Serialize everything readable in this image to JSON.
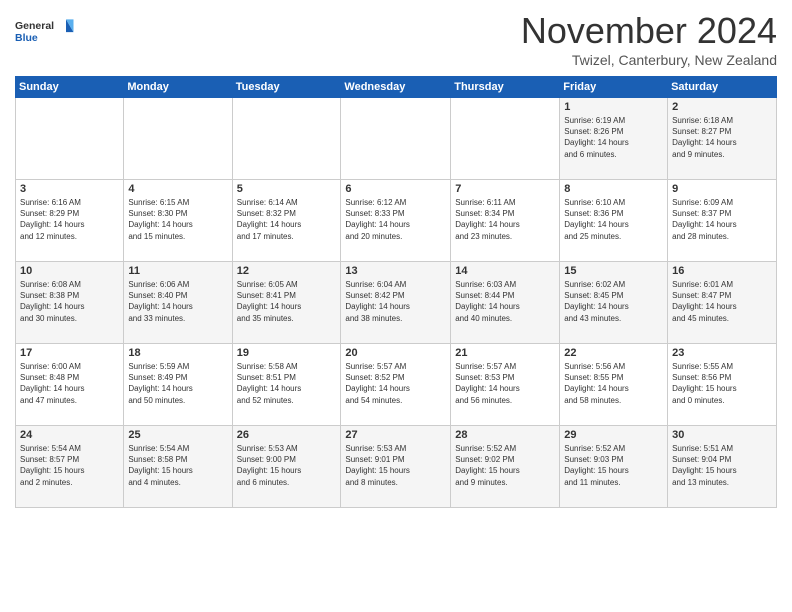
{
  "header": {
    "logo_general": "General",
    "logo_blue": "Blue",
    "month_title": "November 2024",
    "location": "Twizel, Canterbury, New Zealand"
  },
  "weekdays": [
    "Sunday",
    "Monday",
    "Tuesday",
    "Wednesday",
    "Thursday",
    "Friday",
    "Saturday"
  ],
  "weeks": [
    [
      {
        "day": "",
        "info": ""
      },
      {
        "day": "",
        "info": ""
      },
      {
        "day": "",
        "info": ""
      },
      {
        "day": "",
        "info": ""
      },
      {
        "day": "",
        "info": ""
      },
      {
        "day": "1",
        "info": "Sunrise: 6:19 AM\nSunset: 8:26 PM\nDaylight: 14 hours\nand 6 minutes."
      },
      {
        "day": "2",
        "info": "Sunrise: 6:18 AM\nSunset: 8:27 PM\nDaylight: 14 hours\nand 9 minutes."
      }
    ],
    [
      {
        "day": "3",
        "info": "Sunrise: 6:16 AM\nSunset: 8:29 PM\nDaylight: 14 hours\nand 12 minutes."
      },
      {
        "day": "4",
        "info": "Sunrise: 6:15 AM\nSunset: 8:30 PM\nDaylight: 14 hours\nand 15 minutes."
      },
      {
        "day": "5",
        "info": "Sunrise: 6:14 AM\nSunset: 8:32 PM\nDaylight: 14 hours\nand 17 minutes."
      },
      {
        "day": "6",
        "info": "Sunrise: 6:12 AM\nSunset: 8:33 PM\nDaylight: 14 hours\nand 20 minutes."
      },
      {
        "day": "7",
        "info": "Sunrise: 6:11 AM\nSunset: 8:34 PM\nDaylight: 14 hours\nand 23 minutes."
      },
      {
        "day": "8",
        "info": "Sunrise: 6:10 AM\nSunset: 8:36 PM\nDaylight: 14 hours\nand 25 minutes."
      },
      {
        "day": "9",
        "info": "Sunrise: 6:09 AM\nSunset: 8:37 PM\nDaylight: 14 hours\nand 28 minutes."
      }
    ],
    [
      {
        "day": "10",
        "info": "Sunrise: 6:08 AM\nSunset: 8:38 PM\nDaylight: 14 hours\nand 30 minutes."
      },
      {
        "day": "11",
        "info": "Sunrise: 6:06 AM\nSunset: 8:40 PM\nDaylight: 14 hours\nand 33 minutes."
      },
      {
        "day": "12",
        "info": "Sunrise: 6:05 AM\nSunset: 8:41 PM\nDaylight: 14 hours\nand 35 minutes."
      },
      {
        "day": "13",
        "info": "Sunrise: 6:04 AM\nSunset: 8:42 PM\nDaylight: 14 hours\nand 38 minutes."
      },
      {
        "day": "14",
        "info": "Sunrise: 6:03 AM\nSunset: 8:44 PM\nDaylight: 14 hours\nand 40 minutes."
      },
      {
        "day": "15",
        "info": "Sunrise: 6:02 AM\nSunset: 8:45 PM\nDaylight: 14 hours\nand 43 minutes."
      },
      {
        "day": "16",
        "info": "Sunrise: 6:01 AM\nSunset: 8:47 PM\nDaylight: 14 hours\nand 45 minutes."
      }
    ],
    [
      {
        "day": "17",
        "info": "Sunrise: 6:00 AM\nSunset: 8:48 PM\nDaylight: 14 hours\nand 47 minutes."
      },
      {
        "day": "18",
        "info": "Sunrise: 5:59 AM\nSunset: 8:49 PM\nDaylight: 14 hours\nand 50 minutes."
      },
      {
        "day": "19",
        "info": "Sunrise: 5:58 AM\nSunset: 8:51 PM\nDaylight: 14 hours\nand 52 minutes."
      },
      {
        "day": "20",
        "info": "Sunrise: 5:57 AM\nSunset: 8:52 PM\nDaylight: 14 hours\nand 54 minutes."
      },
      {
        "day": "21",
        "info": "Sunrise: 5:57 AM\nSunset: 8:53 PM\nDaylight: 14 hours\nand 56 minutes."
      },
      {
        "day": "22",
        "info": "Sunrise: 5:56 AM\nSunset: 8:55 PM\nDaylight: 14 hours\nand 58 minutes."
      },
      {
        "day": "23",
        "info": "Sunrise: 5:55 AM\nSunset: 8:56 PM\nDaylight: 15 hours\nand 0 minutes."
      }
    ],
    [
      {
        "day": "24",
        "info": "Sunrise: 5:54 AM\nSunset: 8:57 PM\nDaylight: 15 hours\nand 2 minutes."
      },
      {
        "day": "25",
        "info": "Sunrise: 5:54 AM\nSunset: 8:58 PM\nDaylight: 15 hours\nand 4 minutes."
      },
      {
        "day": "26",
        "info": "Sunrise: 5:53 AM\nSunset: 9:00 PM\nDaylight: 15 hours\nand 6 minutes."
      },
      {
        "day": "27",
        "info": "Sunrise: 5:53 AM\nSunset: 9:01 PM\nDaylight: 15 hours\nand 8 minutes."
      },
      {
        "day": "28",
        "info": "Sunrise: 5:52 AM\nSunset: 9:02 PM\nDaylight: 15 hours\nand 9 minutes."
      },
      {
        "day": "29",
        "info": "Sunrise: 5:52 AM\nSunset: 9:03 PM\nDaylight: 15 hours\nand 11 minutes."
      },
      {
        "day": "30",
        "info": "Sunrise: 5:51 AM\nSunset: 9:04 PM\nDaylight: 15 hours\nand 13 minutes."
      }
    ]
  ]
}
